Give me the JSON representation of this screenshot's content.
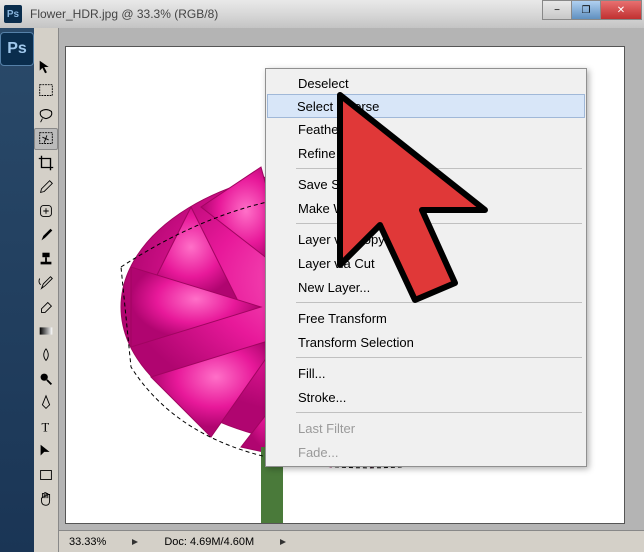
{
  "titlebar": {
    "app_icon": "Ps",
    "title": "Flower_HDR.jpg @ 33.3% (RGB/8)"
  },
  "left_strip": {
    "logo": "Ps"
  },
  "tools": [
    {
      "name": "move-tool"
    },
    {
      "name": "marquee-tool"
    },
    {
      "name": "lasso-tool"
    },
    {
      "name": "magic-wand-tool"
    },
    {
      "name": "crop-tool"
    },
    {
      "name": "eyedropper-tool"
    },
    {
      "name": "healing-brush-tool"
    },
    {
      "name": "brush-tool"
    },
    {
      "name": "clone-stamp-tool"
    },
    {
      "name": "history-brush-tool"
    },
    {
      "name": "eraser-tool"
    },
    {
      "name": "gradient-tool"
    },
    {
      "name": "blur-tool"
    },
    {
      "name": "dodge-tool"
    },
    {
      "name": "pen-tool"
    },
    {
      "name": "type-tool"
    },
    {
      "name": "path-select-tool"
    },
    {
      "name": "shape-tool"
    },
    {
      "name": "hand-tool"
    }
  ],
  "context_menu": {
    "items": [
      {
        "label": "Deselect",
        "enabled": true,
        "highlighted": false
      },
      {
        "label": "Select Inverse",
        "enabled": true,
        "highlighted": true
      },
      {
        "label": "Feather...",
        "enabled": true
      },
      {
        "label": "Refine Edge...",
        "enabled": true
      },
      {
        "sep": true
      },
      {
        "label": "Save Selection...",
        "enabled": true
      },
      {
        "label": "Make Work Path...",
        "enabled": true
      },
      {
        "sep": true
      },
      {
        "label": "Layer via Copy",
        "enabled": true
      },
      {
        "label": "Layer via Cut",
        "enabled": true
      },
      {
        "label": "New Layer...",
        "enabled": true
      },
      {
        "sep": true
      },
      {
        "label": "Free Transform",
        "enabled": true
      },
      {
        "label": "Transform Selection",
        "enabled": true
      },
      {
        "sep": true
      },
      {
        "label": "Fill...",
        "enabled": true
      },
      {
        "label": "Stroke...",
        "enabled": true
      },
      {
        "sep": true
      },
      {
        "label": "Last Filter",
        "enabled": false
      },
      {
        "label": "Fade...",
        "enabled": false
      }
    ]
  },
  "status_bar": {
    "zoom": "33.33%",
    "doc_info": "Doc: 4.69M/4.60M"
  },
  "colors": {
    "highlight_box": "#d91e1e",
    "menu_highlight": "#d8e6f8",
    "flower": "#e8199a"
  }
}
